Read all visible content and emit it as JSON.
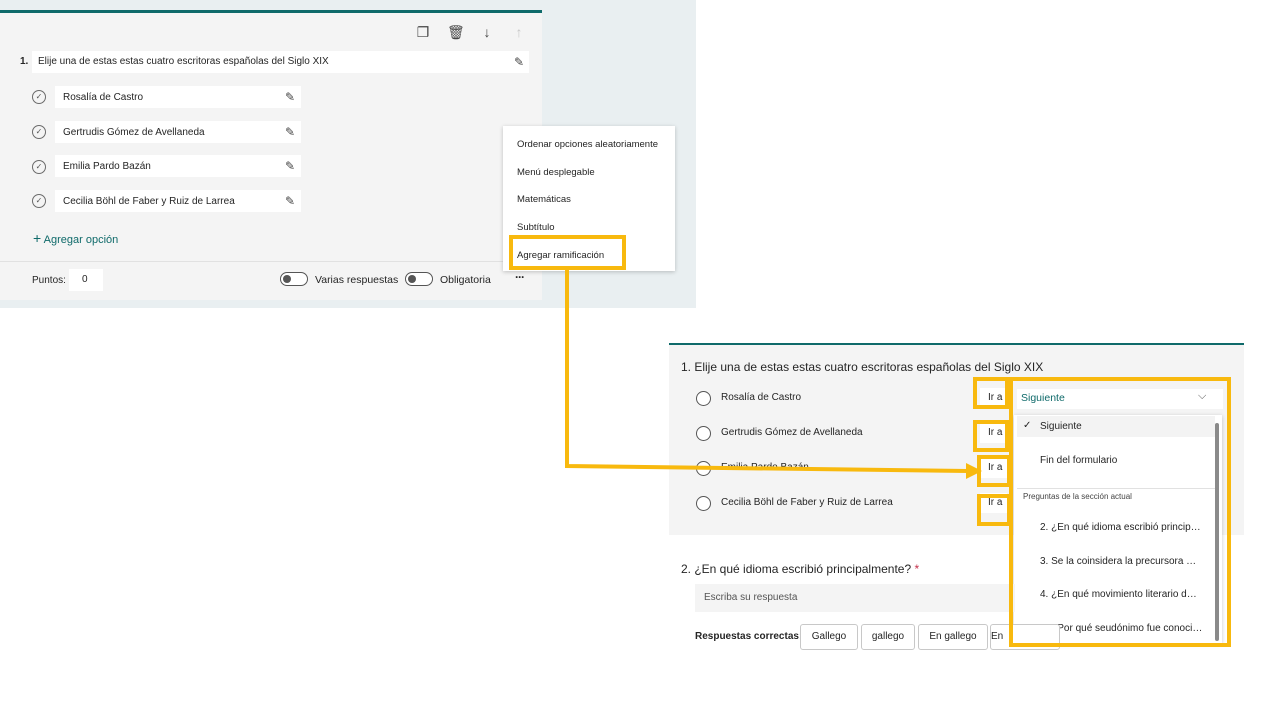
{
  "editor": {
    "question_number": "1.",
    "question_title": "Elije una de estas estas cuatro escritoras españolas del Siglo XIX",
    "toolbar_icons": [
      "copy-icon",
      "trash-icon",
      "move-down-icon",
      "move-up-icon"
    ],
    "options": [
      "Rosalía de Castro",
      "Gertrudis Gómez de Avellaneda",
      "Emilia Pardo Bazán",
      "Cecilia Böhl de Faber y Ruiz de Larrea"
    ],
    "add_option_label": "Agregar opción",
    "points_label": "Puntos:",
    "points_value": "0",
    "multiple_answers_label": "Varias respuestas",
    "required_label": "Obligatoria",
    "more_icon": "···"
  },
  "context_menu": {
    "items": [
      "Ordenar opciones aleatoriamente",
      "Menú desplegable",
      "Matemáticas",
      "Subtítulo",
      "Agregar ramificación"
    ]
  },
  "preview": {
    "question1_title": "1. Elije una de estas estas cuatro escritoras españolas del Siglo XIX",
    "options": [
      "Rosalía de Castro",
      "Gertrudis Gómez de Avellaneda",
      "Emilia Pardo Bazán",
      "Cecilia Böhl de Faber y Ruiz de Larrea"
    ],
    "go_to_label": "Ir a",
    "dropdown": {
      "selected": "Siguiente",
      "items": [
        "Siguiente",
        "Fin del formulario"
      ],
      "group_header": "Preguntas de la sección actual",
      "questions": [
        "2. ¿En qué idioma escribió princip…",
        "3. Se la coinsidera la precursora …",
        "4. ¿En qué movimiento literario d…",
        "5. ¿Por qué seudónimo fue conoci…"
      ]
    },
    "question2_title": "2. ¿En qué idioma escribió principalmente?",
    "required_mark": "*",
    "answer_placeholder": "Escriba su respuesta",
    "correct_answers_label": "Respuestas correctas:",
    "correct_answers": [
      "Gallego",
      "gallego",
      "En gallego",
      "En"
    ]
  },
  "colors": {
    "accent": "#0f6a6a",
    "highlight": "#f8b90e"
  }
}
